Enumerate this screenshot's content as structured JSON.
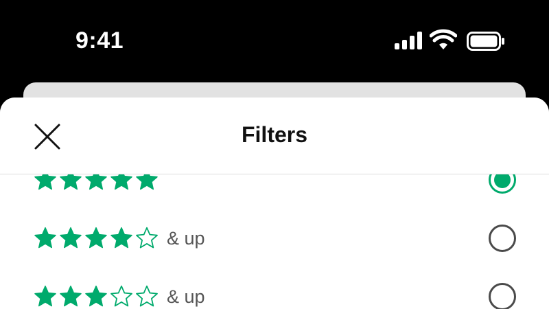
{
  "status_bar": {
    "time": "9:41"
  },
  "sheet": {
    "title": "Filters"
  },
  "rating_options": [
    {
      "filled_stars": 5,
      "total_stars": 5,
      "label": "",
      "selected": true
    },
    {
      "filled_stars": 4,
      "total_stars": 5,
      "label": "& up",
      "selected": false
    },
    {
      "filled_stars": 3,
      "total_stars": 5,
      "label": "& up",
      "selected": false
    }
  ],
  "colors": {
    "accent": "#00aa6c",
    "radio_border": "#4a4a4a",
    "text": "#111111",
    "secondary_text": "#555555"
  },
  "icons": {
    "close": "close-icon",
    "star": "star-icon"
  }
}
